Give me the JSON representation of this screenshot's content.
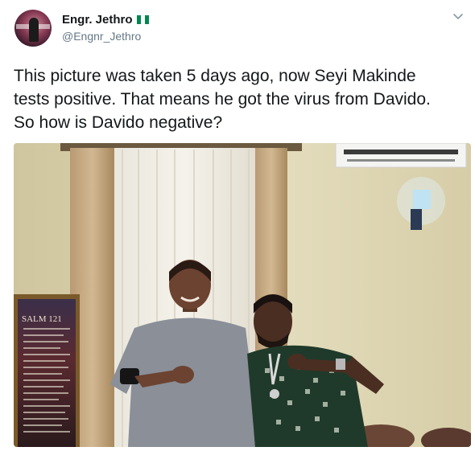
{
  "author": {
    "name": "Engr. Jethro",
    "handle": "@Engnr_Jethro",
    "flag_colors": [
      "#008751",
      "#ffffff",
      "#008751"
    ]
  },
  "tweet": {
    "lines": [
      "This picture was taken 5 days ago, now Seyi Makinde",
      "tests positive. That means he got the virus from Davido.",
      "So how is Davido negative?"
    ]
  },
  "media": {
    "plaque_title": "SALM 121"
  },
  "colors": {
    "text": "#14171a",
    "secondary": "#657786"
  }
}
